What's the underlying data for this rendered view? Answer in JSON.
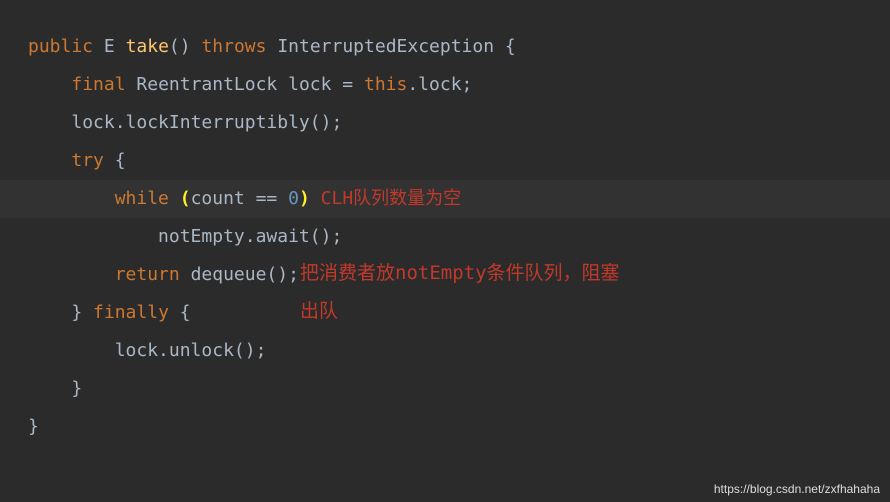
{
  "code": {
    "line1": {
      "public": "public",
      "type": "E",
      "method": "take",
      "parens": "()",
      "throws": "throws",
      "exception": "InterruptedException",
      "brace": " {"
    },
    "line2": {
      "indent": "    ",
      "final": "final",
      "type": "ReentrantLock",
      "var": "lock = ",
      "this": "this",
      "rest": ".lock;"
    },
    "line3": {
      "indent": "    ",
      "text": "lock.lockInterruptibly();"
    },
    "line4": {
      "indent": "    ",
      "try": "try",
      "brace": " {"
    },
    "line5": {
      "indent": "        ",
      "while": "while",
      "lparen": " (",
      "expr": "count == ",
      "zero": "0",
      "rparen": ")"
    },
    "line6": {
      "indent": "            ",
      "text": "notEmpty.await();"
    },
    "line7": {
      "indent": "        ",
      "return": "return",
      "text": " dequeue();"
    },
    "line8": {
      "indent": "    ",
      "text": "} ",
      "finally": "finally",
      "brace": " {"
    },
    "line9": {
      "indent": "        ",
      "text": "lock.unlock();"
    },
    "line10": {
      "indent": "    ",
      "text": "}"
    },
    "line11": {
      "text": "}"
    }
  },
  "annotations": {
    "a1": " CLH队列数量为空",
    "a2": "把消费者放notEmpty条件队列，阻塞",
    "a3": "出队"
  },
  "watermark": "https://blog.csdn.net/zxfhahaha"
}
